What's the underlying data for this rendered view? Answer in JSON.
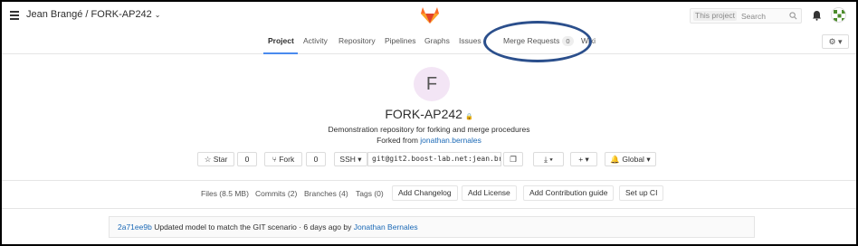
{
  "header": {
    "project_title": "Jean Brangé / FORK-AP242",
    "search_scope": "This project",
    "search_placeholder": "Search"
  },
  "nav": {
    "tabs": [
      {
        "label": "Project",
        "active": true
      },
      {
        "label": "Activity"
      },
      {
        "label": "Repository"
      },
      {
        "label": "Pipelines"
      },
      {
        "label": "Graphs"
      },
      {
        "label": "Issues"
      },
      {
        "label": "Merge Requests",
        "count": "0"
      },
      {
        "label": "Wiki"
      }
    ]
  },
  "project": {
    "avatar_letter": "F",
    "name": "FORK-AP242",
    "description": "Demonstration repository for forking and merge procedures",
    "forked_prefix": "Forked from",
    "forked_from": "jonathan.bernales"
  },
  "actions": {
    "star_label": "Star",
    "star_count": "0",
    "fork_label": "Fork",
    "fork_count": "0",
    "protocol": "SSH",
    "clone_url": "git@git2.boost-lab.net:jean.br",
    "visibility": "Global"
  },
  "stats": {
    "files": "Files (8.5 MB)",
    "commits": "Commits (2)",
    "branches": "Branches (4)",
    "tags": "Tags (0)",
    "add_changelog": "Add Changelog",
    "add_license": "Add License",
    "add_contribution": "Add Contribution guide",
    "setup_ci": "Set up CI"
  },
  "last_commit": {
    "sha": "2a71ee9b",
    "message": "Updated model to match the GIT scenario · 6 days ago by",
    "author": "Jonathan Bernales"
  },
  "colors": {
    "link": "#1b69b6",
    "active_tab": "#4a8bee",
    "annotation_ellipse": "#2b4f8c",
    "avatar_bg": "#f3e5f5"
  }
}
